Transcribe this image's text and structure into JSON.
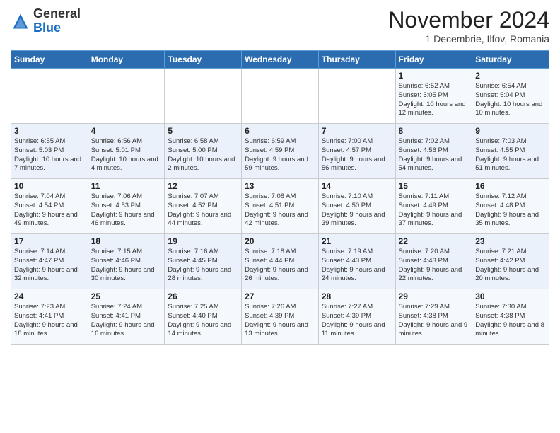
{
  "header": {
    "logo_general": "General",
    "logo_blue": "Blue",
    "month_title": "November 2024",
    "subtitle": "1 Decembrie, Ilfov, Romania"
  },
  "days_of_week": [
    "Sunday",
    "Monday",
    "Tuesday",
    "Wednesday",
    "Thursday",
    "Friday",
    "Saturday"
  ],
  "weeks": [
    [
      {
        "day": "",
        "info": ""
      },
      {
        "day": "",
        "info": ""
      },
      {
        "day": "",
        "info": ""
      },
      {
        "day": "",
        "info": ""
      },
      {
        "day": "",
        "info": ""
      },
      {
        "day": "1",
        "info": "Sunrise: 6:52 AM\nSunset: 5:05 PM\nDaylight: 10 hours and 12 minutes."
      },
      {
        "day": "2",
        "info": "Sunrise: 6:54 AM\nSunset: 5:04 PM\nDaylight: 10 hours and 10 minutes."
      }
    ],
    [
      {
        "day": "3",
        "info": "Sunrise: 6:55 AM\nSunset: 5:03 PM\nDaylight: 10 hours and 7 minutes."
      },
      {
        "day": "4",
        "info": "Sunrise: 6:56 AM\nSunset: 5:01 PM\nDaylight: 10 hours and 4 minutes."
      },
      {
        "day": "5",
        "info": "Sunrise: 6:58 AM\nSunset: 5:00 PM\nDaylight: 10 hours and 2 minutes."
      },
      {
        "day": "6",
        "info": "Sunrise: 6:59 AM\nSunset: 4:59 PM\nDaylight: 9 hours and 59 minutes."
      },
      {
        "day": "7",
        "info": "Sunrise: 7:00 AM\nSunset: 4:57 PM\nDaylight: 9 hours and 56 minutes."
      },
      {
        "day": "8",
        "info": "Sunrise: 7:02 AM\nSunset: 4:56 PM\nDaylight: 9 hours and 54 minutes."
      },
      {
        "day": "9",
        "info": "Sunrise: 7:03 AM\nSunset: 4:55 PM\nDaylight: 9 hours and 51 minutes."
      }
    ],
    [
      {
        "day": "10",
        "info": "Sunrise: 7:04 AM\nSunset: 4:54 PM\nDaylight: 9 hours and 49 minutes."
      },
      {
        "day": "11",
        "info": "Sunrise: 7:06 AM\nSunset: 4:53 PM\nDaylight: 9 hours and 46 minutes."
      },
      {
        "day": "12",
        "info": "Sunrise: 7:07 AM\nSunset: 4:52 PM\nDaylight: 9 hours and 44 minutes."
      },
      {
        "day": "13",
        "info": "Sunrise: 7:08 AM\nSunset: 4:51 PM\nDaylight: 9 hours and 42 minutes."
      },
      {
        "day": "14",
        "info": "Sunrise: 7:10 AM\nSunset: 4:50 PM\nDaylight: 9 hours and 39 minutes."
      },
      {
        "day": "15",
        "info": "Sunrise: 7:11 AM\nSunset: 4:49 PM\nDaylight: 9 hours and 37 minutes."
      },
      {
        "day": "16",
        "info": "Sunrise: 7:12 AM\nSunset: 4:48 PM\nDaylight: 9 hours and 35 minutes."
      }
    ],
    [
      {
        "day": "17",
        "info": "Sunrise: 7:14 AM\nSunset: 4:47 PM\nDaylight: 9 hours and 32 minutes."
      },
      {
        "day": "18",
        "info": "Sunrise: 7:15 AM\nSunset: 4:46 PM\nDaylight: 9 hours and 30 minutes."
      },
      {
        "day": "19",
        "info": "Sunrise: 7:16 AM\nSunset: 4:45 PM\nDaylight: 9 hours and 28 minutes."
      },
      {
        "day": "20",
        "info": "Sunrise: 7:18 AM\nSunset: 4:44 PM\nDaylight: 9 hours and 26 minutes."
      },
      {
        "day": "21",
        "info": "Sunrise: 7:19 AM\nSunset: 4:43 PM\nDaylight: 9 hours and 24 minutes."
      },
      {
        "day": "22",
        "info": "Sunrise: 7:20 AM\nSunset: 4:43 PM\nDaylight: 9 hours and 22 minutes."
      },
      {
        "day": "23",
        "info": "Sunrise: 7:21 AM\nSunset: 4:42 PM\nDaylight: 9 hours and 20 minutes."
      }
    ],
    [
      {
        "day": "24",
        "info": "Sunrise: 7:23 AM\nSunset: 4:41 PM\nDaylight: 9 hours and 18 minutes."
      },
      {
        "day": "25",
        "info": "Sunrise: 7:24 AM\nSunset: 4:41 PM\nDaylight: 9 hours and 16 minutes."
      },
      {
        "day": "26",
        "info": "Sunrise: 7:25 AM\nSunset: 4:40 PM\nDaylight: 9 hours and 14 minutes."
      },
      {
        "day": "27",
        "info": "Sunrise: 7:26 AM\nSunset: 4:39 PM\nDaylight: 9 hours and 13 minutes."
      },
      {
        "day": "28",
        "info": "Sunrise: 7:27 AM\nSunset: 4:39 PM\nDaylight: 9 hours and 11 minutes."
      },
      {
        "day": "29",
        "info": "Sunrise: 7:29 AM\nSunset: 4:38 PM\nDaylight: 9 hours and 9 minutes."
      },
      {
        "day": "30",
        "info": "Sunrise: 7:30 AM\nSunset: 4:38 PM\nDaylight: 9 hours and 8 minutes."
      }
    ]
  ]
}
